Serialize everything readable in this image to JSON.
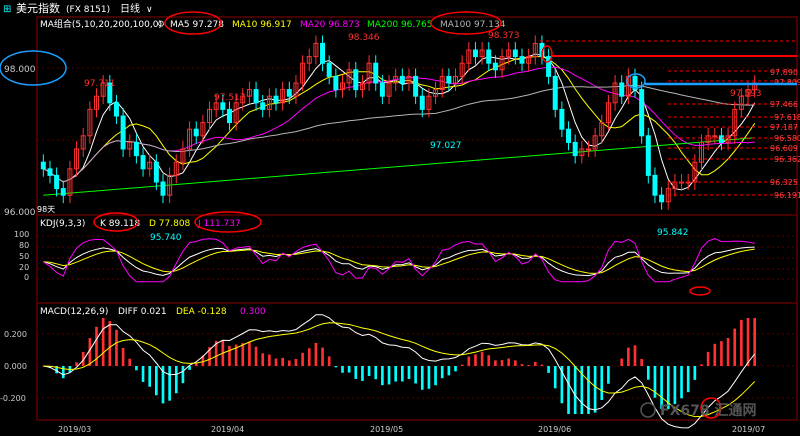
{
  "header": {
    "title": "美元指数",
    "code": "(FX 8151)",
    "period": "日线",
    "dropdown_glyph": "∨"
  },
  "colors": {
    "background": "#000000",
    "frame": "#8b0000",
    "grid": "#5a0000",
    "up": "#ff3030",
    "down": "#00ffff",
    "ma5": "#ffffff",
    "ma10": "#ffff00",
    "ma20": "#ff00ff",
    "ma200": "#00ff00",
    "ma100": "#b4b4b4",
    "annot_red": "#ff0000",
    "annot_blue": "#1a9fff",
    "fib_text": "#ff4040"
  },
  "main_panel": {
    "legend": {
      "label": "MA组合(5,10,20,200,100,0)",
      "ma5": "MA5 97.278",
      "ma10": "MA10 96.917",
      "ma20": "MA20 96.873",
      "ma200": "MA200 96.765",
      "ma100": "MA100 97.134"
    },
    "y_ticks": [
      "98.000",
      "96.000"
    ],
    "price_labels": {
      "high1": "97.711",
      "high2": "97.517",
      "high3": "98.346",
      "high4": "98.373",
      "low1": "95.740",
      "low2": "97.027",
      "low3": "95.842",
      "last_high": "97.593",
      "count": "98天"
    },
    "fib_levels": [
      "97.890",
      "97.809",
      "97.466",
      "97.618",
      "97.187",
      "96.580",
      "96.609",
      "96.362",
      "96.325",
      "96.191"
    ]
  },
  "kdj_panel": {
    "label": "KDJ(9,3,3)",
    "k": "K 89.118",
    "d": "D 77.808",
    "j": "J 111.737",
    "y_ticks": [
      "100",
      "80",
      "50",
      "20",
      "0"
    ]
  },
  "macd_panel": {
    "label": "MACD(12,26,9)",
    "diff": "DIFF 0.021",
    "dea": "DEA -0.128",
    "macd": "0.300",
    "y_ticks": [
      "0.200",
      "0.000",
      "-0.200"
    ]
  },
  "x_axis": {
    "labels": [
      "2019/03",
      "2019/04",
      "2019/05",
      "2019/06",
      "2019/07"
    ]
  },
  "watermark": "FX678 汇通网",
  "chart_data": [
    {
      "type": "candlestick",
      "title": "美元指数 (FX 8151) 日线",
      "x": [
        "2019/03",
        "2019/04",
        "2019/05",
        "2019/06",
        "2019/07"
      ],
      "ylim": [
        95.6,
        98.6
      ],
      "series": [
        {
          "name": "MA5",
          "last": 97.278
        },
        {
          "name": "MA10",
          "last": 96.917
        },
        {
          "name": "MA20",
          "last": 96.873
        },
        {
          "name": "MA200",
          "last": 96.765
        },
        {
          "name": "MA100",
          "last": 97.134
        }
      ],
      "close": [
        96.3,
        96.2,
        96.0,
        95.9,
        96.3,
        96.6,
        96.8,
        97.2,
        97.4,
        97.6,
        97.3,
        97.1,
        96.6,
        96.7,
        96.5,
        96.3,
        96.4,
        96.1,
        95.9,
        96.2,
        96.4,
        96.6,
        96.9,
        96.8,
        97.0,
        97.2,
        97.3,
        97.2,
        97.0,
        97.3,
        97.4,
        97.5,
        97.3,
        97.2,
        97.4,
        97.3,
        97.5,
        97.4,
        97.6,
        97.9,
        98.0,
        98.2,
        97.9,
        97.7,
        97.5,
        97.6,
        97.8,
        97.5,
        97.6,
        97.9,
        97.6,
        97.4,
        97.6,
        97.7,
        97.6,
        97.7,
        97.4,
        97.2,
        97.4,
        97.5,
        97.7,
        97.6,
        97.7,
        97.9,
        98.1,
        98.0,
        98.1,
        97.9,
        97.8,
        98.0,
        98.1,
        98.0,
        97.9,
        98.0,
        98.2,
        98.0,
        97.7,
        97.2,
        96.9,
        96.7,
        96.5,
        96.6,
        96.6,
        96.8,
        97.0,
        97.3,
        97.6,
        97.4,
        97.7,
        97.5,
        96.8,
        96.2,
        95.9,
        95.8,
        96.0,
        96.1,
        96.1,
        96.1,
        96.4,
        96.7,
        96.8,
        96.8,
        96.7,
        96.8,
        97.2,
        97.4,
        97.5,
        97.6
      ],
      "open": [
        96.4,
        96.3,
        96.2,
        96.0,
        95.9,
        96.3,
        96.6,
        96.8,
        97.2,
        97.4,
        97.6,
        97.3,
        97.1,
        96.6,
        96.7,
        96.5,
        96.3,
        96.4,
        96.1,
        95.9,
        96.2,
        96.4,
        96.6,
        96.9,
        96.8,
        97.0,
        97.2,
        97.3,
        97.2,
        97.0,
        97.3,
        97.4,
        97.5,
        97.3,
        97.2,
        97.4,
        97.3,
        97.5,
        97.4,
        97.6,
        97.9,
        98.0,
        98.2,
        97.9,
        97.7,
        97.5,
        97.6,
        97.8,
        97.5,
        97.6,
        97.9,
        97.6,
        97.4,
        97.6,
        97.7,
        97.6,
        97.7,
        97.4,
        97.2,
        97.4,
        97.5,
        97.7,
        97.6,
        97.7,
        97.9,
        98.1,
        98.0,
        98.1,
        97.9,
        97.8,
        98.0,
        98.1,
        98.0,
        97.9,
        98.0,
        98.2,
        98.0,
        97.7,
        97.2,
        96.9,
        96.7,
        96.5,
        96.6,
        96.6,
        96.8,
        97.0,
        97.3,
        97.6,
        97.4,
        97.7,
        97.5,
        96.8,
        96.2,
        95.9,
        95.8,
        96.0,
        96.1,
        96.1,
        96.1,
        96.4,
        96.7,
        96.8,
        96.8,
        96.7,
        96.8,
        97.2,
        97.4,
        97.5
      ]
    },
    {
      "type": "line",
      "title": "KDJ(9,3,3)",
      "ylim": [
        0,
        120
      ],
      "series": [
        {
          "name": "K",
          "last": 89.118
        },
        {
          "name": "D",
          "last": 77.808
        },
        {
          "name": "J",
          "last": 111.737
        }
      ]
    },
    {
      "type": "bar",
      "title": "MACD(12,26,9)",
      "ylim": [
        -0.3,
        0.3
      ],
      "series": [
        {
          "name": "DIFF",
          "last": 0.021
        },
        {
          "name": "DEA",
          "last": -0.128
        },
        {
          "name": "MACD",
          "last": 0.3
        }
      ]
    }
  ]
}
